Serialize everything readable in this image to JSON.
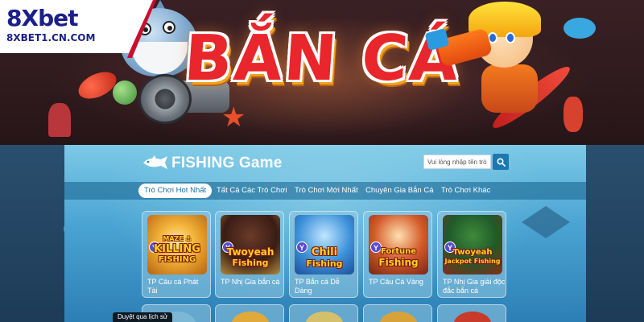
{
  "brand": {
    "logo": "8Xbet",
    "domain": "8XBET1.CN.COM"
  },
  "banner": {
    "title": "BẮN CÁ"
  },
  "lobby": {
    "title": "FISHING Game",
    "search": {
      "placeholder": "Vui lòng nhập tên trò chơi",
      "button_icon": "search-icon"
    },
    "tabs": [
      {
        "label": "Trò Chơi Hot Nhất",
        "active": true
      },
      {
        "label": "Tất Cả Các Trò Chơi",
        "active": false
      },
      {
        "label": "Trò Chơi Mới Nhất",
        "active": false
      },
      {
        "label": "Chuyên Gia Bắn Cá",
        "active": false
      },
      {
        "label": "Trò Chơi Khác",
        "active": false
      }
    ],
    "games": [
      {
        "logo_line1": "MAZE ⚓",
        "logo_line2": "KILLING",
        "logo_line3": "FISHING",
        "label": "TP Câu cá Phát Tài"
      },
      {
        "logo_line1": "",
        "logo_line2": "Twoyeah",
        "logo_line3": "Fishing",
        "label": "TP Nhị Gia bắn cá"
      },
      {
        "logo_line1": "",
        "logo_line2": "Chili",
        "logo_line3": "Fishing",
        "label": "TP Bắn cá Dễ Dàng"
      },
      {
        "logo_line1": "",
        "logo_line2": "Fortune",
        "logo_line3": "Fishing",
        "label": "TP Câu Cá Vàng"
      },
      {
        "logo_line1": "",
        "logo_line2": "Twoyeah",
        "logo_line3": "Jackpot Fishing",
        "label": "TP Nhị Gia giải độc đắc bắn cá"
      }
    ],
    "history_tab": "Duyệt qua lịch sử"
  },
  "colors": {
    "brand_navy": "#1b1f8a",
    "brand_red": "#c8102e",
    "title_red": "#e8262b",
    "lobby_blue": "#4aa4d2",
    "search_button": "#1d78b0",
    "tab_active_text": "#1c6fa6"
  }
}
